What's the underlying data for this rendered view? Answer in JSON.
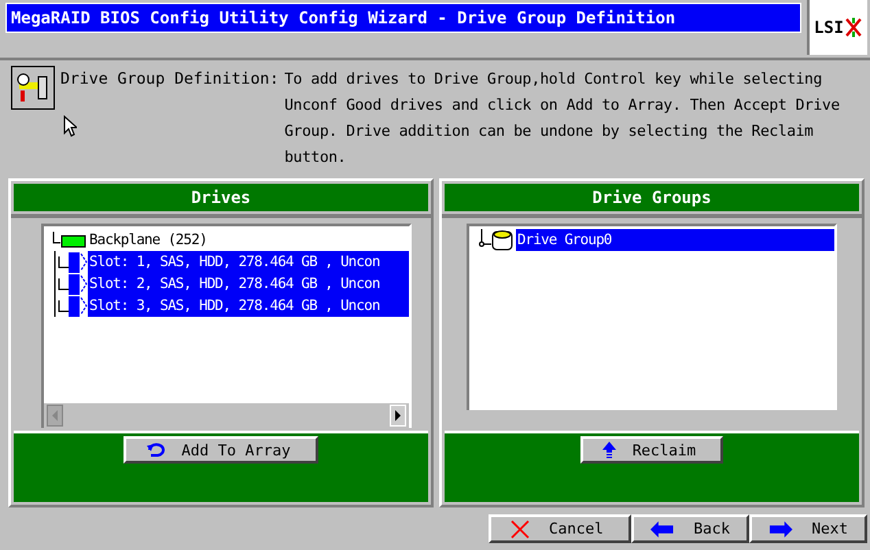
{
  "window": {
    "title": "MegaRAID BIOS Config Utility  Config Wizard - Drive Group Definition",
    "logo": "LSI"
  },
  "description": {
    "label": "Drive Group Definition:",
    "text": "To add drives to Drive Group,hold Control key while selecting Unconf Good drives and click on Add to Array. Then Accept Drive Group. Drive addition can be undone by selecting the Reclaim button."
  },
  "drives": {
    "title": "Drives",
    "tree": [
      {
        "label": "Backplane (252)",
        "selected": false,
        "children": [
          {
            "label": "Slot: 1, SAS, HDD, 278.464 GB , Uncon",
            "selected": true
          },
          {
            "label": "Slot: 2, SAS, HDD, 278.464 GB , Uncon",
            "selected": true
          },
          {
            "label": "Slot: 3, SAS, HDD, 278.464 GB , Uncon",
            "selected": true
          }
        ]
      }
    ],
    "button": "Add To Array"
  },
  "drive_groups": {
    "title": "Drive Groups",
    "tree": [
      {
        "label": "Drive Group0",
        "selected": true
      }
    ],
    "button": "Reclaim"
  },
  "footer_buttons": [
    {
      "kind": "cancel",
      "label": "Cancel"
    },
    {
      "kind": "back",
      "label": "Back"
    },
    {
      "kind": "next",
      "label": "Next"
    }
  ]
}
